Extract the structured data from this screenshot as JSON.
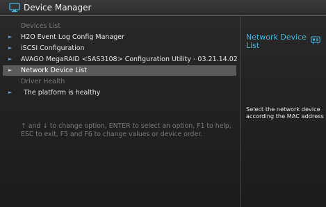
{
  "window": {
    "title": "Device Manager",
    "icon": "monitor-icon"
  },
  "menu": {
    "section_devices": "Devices List",
    "items": [
      {
        "label": "H2O Event Log Config Manager"
      },
      {
        "label": "iSCSI Configuration"
      },
      {
        "label": "AVAGO MegaRAID <SAS3108> Configuration Utility - 03.21.14.02"
      },
      {
        "label": "Network Device List"
      }
    ],
    "section_health": "Driver Health",
    "health_item": "The platform is healthy"
  },
  "help_text": "↑ and ↓ to change option, ENTER to select an option, F1 to help, ESC to exit, F5 and F6 to change values or device order.",
  "right_panel": {
    "title": "Network Device List",
    "icon": "network-card-icon",
    "help": "Select the network device according the MAC address"
  },
  "colors": {
    "accent": "#43b9e0",
    "selected_row": "#5a5a5a",
    "bullet": "#6fa8d8"
  }
}
